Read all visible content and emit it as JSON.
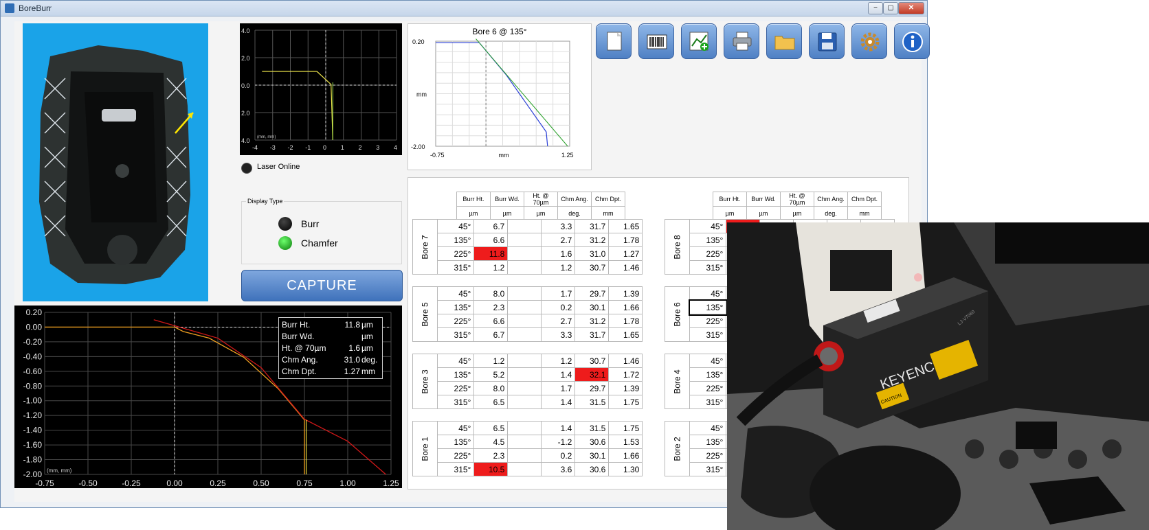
{
  "window": {
    "title": "BoreBurr",
    "min_label": "−",
    "max_label": "▢",
    "close_label": "✕"
  },
  "toolbar": {
    "buttons": [
      {
        "name": "new-document",
        "icon": "document-icon"
      },
      {
        "name": "barcode",
        "icon": "barcode-icon"
      },
      {
        "name": "add-chart",
        "icon": "chart-add-icon"
      },
      {
        "name": "print",
        "icon": "printer-icon"
      },
      {
        "name": "open-folder",
        "icon": "folder-icon"
      },
      {
        "name": "save",
        "icon": "floppy-disk-icon"
      },
      {
        "name": "settings",
        "icon": "gear-icon"
      },
      {
        "name": "info",
        "icon": "info-icon"
      }
    ]
  },
  "top_plot": {
    "y_ticks": [
      "4.0",
      "2.0",
      "0.0",
      "2.0",
      "4.0"
    ],
    "x_ticks": [
      "-4",
      "-3",
      "-2",
      "-1",
      "0",
      "1",
      "2",
      "3",
      "4"
    ],
    "units": "(mm, mm)"
  },
  "bore_plot": {
    "title": "Bore 6 @ 135°",
    "y_top": "0.20",
    "y_bottom": "-2.00",
    "ylabel": "mm",
    "x_left": "-0.75",
    "x_mid": "mm",
    "x_right": "1.25"
  },
  "laser": {
    "label": "Laser Online"
  },
  "display_type": {
    "title": "Display Type",
    "burr": "Burr",
    "chamfer": "Chamfer"
  },
  "capture": {
    "label": "CAPTURE"
  },
  "main_plot": {
    "y_ticks": [
      "0.20",
      "0.00",
      "-0.20",
      "-0.40",
      "-0.60",
      "-0.80",
      "-1.00",
      "-1.20",
      "-1.40",
      "-1.60",
      "-1.80",
      "-2.00"
    ],
    "x_ticks": [
      "-0.75",
      "-0.50",
      "-0.25",
      "0.00",
      "0.25",
      "0.50",
      "0.75",
      "1.00",
      "1.25"
    ],
    "units": "(mm, mm)",
    "readout": [
      {
        "label": "Burr Ht.",
        "value": "11.8",
        "unit": "µm"
      },
      {
        "label": "Burr Wd.",
        "value": "",
        "unit": "µm"
      },
      {
        "label": "Ht. @ 70µm",
        "value": "1.6",
        "unit": "µm"
      },
      {
        "label": "Chm Ang.",
        "value": "31.0",
        "unit": "deg."
      },
      {
        "label": "Chm Dpt.",
        "value": "1.27",
        "unit": "mm"
      }
    ]
  },
  "chart_data": {
    "type": "line",
    "x_range": [
      -0.75,
      1.25
    ],
    "y_range": [
      -2.0,
      0.2
    ],
    "series": [
      {
        "x": [
          -0.75,
          0.0,
          0.05,
          0.2,
          0.4,
          0.6,
          0.75,
          0.75
        ],
        "y": [
          0.0,
          0.0,
          -0.06,
          -0.15,
          -0.41,
          -0.84,
          -1.26,
          -2.0
        ]
      },
      {
        "x": [
          -0.12,
          0.25,
          0.5,
          0.75,
          1.0,
          1.22
        ],
        "y": [
          0.1,
          -0.15,
          -0.55,
          -1.25,
          -1.55,
          -2.0
        ]
      }
    ]
  },
  "table": {
    "headers": [
      {
        "label": "Burr Ht.",
        "unit": "µm"
      },
      {
        "label": "Burr Wd.",
        "unit": "µm"
      },
      {
        "label": "Ht. @ 70µm",
        "unit": "µm"
      },
      {
        "label": "Chm Ang.",
        "unit": "deg."
      },
      {
        "label": "Chm Dpt.",
        "unit": "mm"
      }
    ],
    "left_groups": [
      {
        "name": "Bore 7",
        "rows": [
          {
            "angle": "45°",
            "burr_ht": "6.7",
            "burr_wd": "",
            "ht70": "3.3",
            "chm_ang": "31.7",
            "chm_dpt": "1.65"
          },
          {
            "angle": "135°",
            "burr_ht": "6.6",
            "burr_wd": "",
            "ht70": "2.7",
            "chm_ang": "31.2",
            "chm_dpt": "1.78"
          },
          {
            "angle": "225°",
            "burr_ht": "11.8",
            "burr_wd": "",
            "ht70": "1.6",
            "chm_ang": "31.0",
            "chm_dpt": "1.27",
            "red": "burr_ht"
          },
          {
            "angle": "315°",
            "burr_ht": "1.2",
            "burr_wd": "",
            "ht70": "1.2",
            "chm_ang": "30.7",
            "chm_dpt": "1.46"
          }
        ]
      },
      {
        "name": "Bore 5",
        "rows": [
          {
            "angle": "45°",
            "burr_ht": "8.0",
            "burr_wd": "",
            "ht70": "1.7",
            "chm_ang": "29.7",
            "chm_dpt": "1.39"
          },
          {
            "angle": "135°",
            "burr_ht": "2.3",
            "burr_wd": "",
            "ht70": "0.2",
            "chm_ang": "30.1",
            "chm_dpt": "1.66"
          },
          {
            "angle": "225°",
            "burr_ht": "6.6",
            "burr_wd": "",
            "ht70": "2.7",
            "chm_ang": "31.2",
            "chm_dpt": "1.78"
          },
          {
            "angle": "315°",
            "burr_ht": "6.7",
            "burr_wd": "",
            "ht70": "3.3",
            "chm_ang": "31.7",
            "chm_dpt": "1.65"
          }
        ]
      },
      {
        "name": "Bore 3",
        "rows": [
          {
            "angle": "45°",
            "burr_ht": "1.2",
            "burr_wd": "",
            "ht70": "1.2",
            "chm_ang": "30.7",
            "chm_dpt": "1.46"
          },
          {
            "angle": "135°",
            "burr_ht": "5.2",
            "burr_wd": "",
            "ht70": "1.4",
            "chm_ang": "32.1",
            "chm_dpt": "1.72",
            "red": "chm_ang"
          },
          {
            "angle": "225°",
            "burr_ht": "8.0",
            "burr_wd": "",
            "ht70": "1.7",
            "chm_ang": "29.7",
            "chm_dpt": "1.39"
          },
          {
            "angle": "315°",
            "burr_ht": "6.5",
            "burr_wd": "",
            "ht70": "1.4",
            "chm_ang": "31.5",
            "chm_dpt": "1.75"
          }
        ]
      },
      {
        "name": "Bore 1",
        "rows": [
          {
            "angle": "45°",
            "burr_ht": "6.5",
            "burr_wd": "",
            "ht70": "1.4",
            "chm_ang": "31.5",
            "chm_dpt": "1.75"
          },
          {
            "angle": "135°",
            "burr_ht": "4.5",
            "burr_wd": "",
            "ht70": "-1.2",
            "chm_ang": "30.6",
            "chm_dpt": "1.53"
          },
          {
            "angle": "225°",
            "burr_ht": "2.3",
            "burr_wd": "",
            "ht70": "0.2",
            "chm_ang": "30.1",
            "chm_dpt": "1.66"
          },
          {
            "angle": "315°",
            "burr_ht": "10.5",
            "burr_wd": "",
            "ht70": "3.6",
            "chm_ang": "30.6",
            "chm_dpt": "1.30",
            "red": "burr_ht"
          }
        ]
      }
    ],
    "right_groups": [
      {
        "name": "Bore 8",
        "angles": [
          "45°",
          "135°",
          "225°",
          "315°"
        ]
      },
      {
        "name": "Bore 6",
        "angles": [
          "45°",
          "135°",
          "225°",
          "315°"
        ],
        "selected": 1
      },
      {
        "name": "Bore 4",
        "angles": [
          "45°",
          "135°",
          "225°",
          "315°"
        ]
      },
      {
        "name": "Bore 2",
        "angles": [
          "45°",
          "135°",
          "225°",
          "315°"
        ]
      }
    ]
  },
  "photo": {
    "brand": "KEYENCE",
    "caution": "CAUTION",
    "side_text": "LJ-V7060"
  },
  "colors": {
    "accent": "#4f80c4",
    "plot_bg": "#000000",
    "alarm_red": "#ee1c1c",
    "panel_blue": "#1aa3e8"
  }
}
